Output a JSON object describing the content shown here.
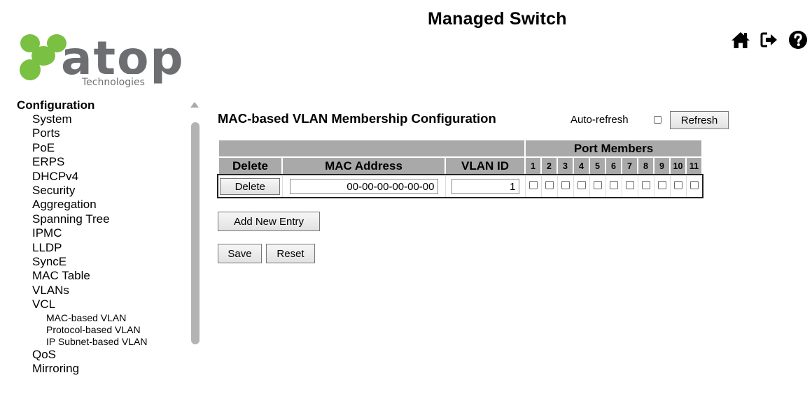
{
  "header": {
    "app_title": "Managed Switch",
    "logo_word": "atop",
    "logo_sub": "Technologies",
    "icons": [
      "home-icon",
      "logout-icon",
      "help-icon"
    ]
  },
  "sidebar": {
    "heading": "Configuration",
    "items": [
      "System",
      "Ports",
      "PoE",
      "ERPS",
      "DHCPv4",
      "Security",
      "Aggregation",
      "Spanning Tree",
      "IPMC",
      "LLDP",
      "SyncE",
      "MAC Table",
      "VLANs",
      "VCL"
    ],
    "vcl_children": [
      "MAC-based VLAN",
      "Protocol-based VLAN",
      "IP Subnet-based VLAN"
    ],
    "after_items": [
      "QoS",
      "Mirroring"
    ]
  },
  "main": {
    "title": "MAC-based VLAN Membership Configuration",
    "auto_refresh_label": "Auto-refresh",
    "refresh_label": "Refresh",
    "table": {
      "group_header": "Port Members",
      "col_delete": "Delete",
      "col_mac": "MAC Address",
      "col_vlan": "VLAN ID",
      "ports": [
        "1",
        "2",
        "3",
        "4",
        "5",
        "6",
        "7",
        "8",
        "9",
        "10",
        "11"
      ],
      "row": {
        "delete_label": "Delete",
        "mac": "00-00-00-00-00-00",
        "vlan_id": "1"
      }
    },
    "add_entry_label": "Add New Entry",
    "save_label": "Save",
    "reset_label": "Reset"
  },
  "colors": {
    "header_gray": "#a9a9a9",
    "logo_green": "#7ac143",
    "logo_gray": "#6d6e71"
  }
}
